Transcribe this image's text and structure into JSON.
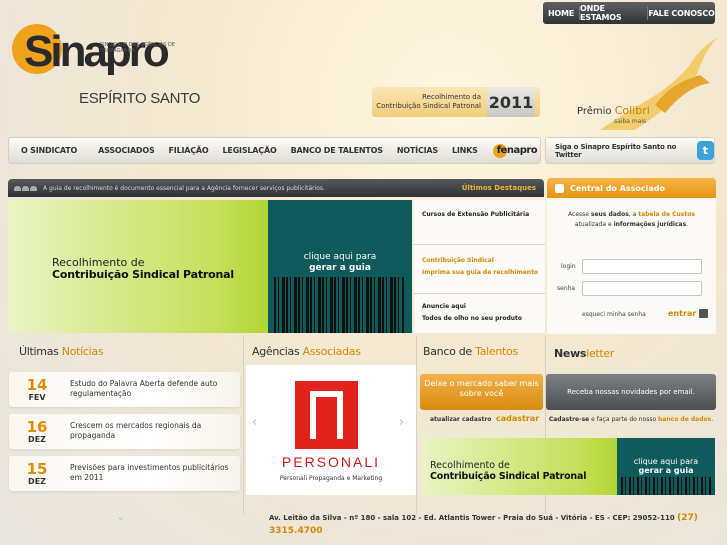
{
  "topnav": {
    "home": "HOME",
    "onde": "ONDE ESTAMOS",
    "fale": "FALE CONOSCO"
  },
  "logo": {
    "word": "Sinapro",
    "small": "SINDICATO DAS AGÊNCIAS DE PROPAGANDA",
    "sub": "ESPÍRITO SANTO"
  },
  "recolhimento": {
    "line1": "Recolhimento da",
    "line2": "Contribuição Sindical Patronal",
    "year": "2011"
  },
  "premio": {
    "label": "Prêmio ",
    "highlight": "Colibri",
    "saiba": "saiba mais"
  },
  "mainnav": {
    "items": [
      "O SINDICATO",
      "ASSOCIADOS",
      "FILIAÇÃO",
      "LEGISLAÇÃO",
      "BANCO DE TALENTOS",
      "NOTÍCIAS",
      "LINKS"
    ],
    "fenapro": "fenapro"
  },
  "twitter": {
    "label": "Siga o Sinapro Espírito Santo no Twitter",
    "icon": "twitter-icon"
  },
  "ticker": {
    "message": "A guia de recolhimento é documento essencial para a Agência fornecer serviços publicitários.",
    "destaques": "Últimos Destaques"
  },
  "banner": {
    "line1": "Recolhimento de",
    "line2": "Contribuição Sindical Patronal",
    "cta1": "clique aqui para",
    "cta2": "gerar a guia"
  },
  "destaques": [
    {
      "l1": "Cursos de Extensão Publicitária",
      "l2": ""
    },
    {
      "l1": "Contribuição Sindical",
      "l2": "Imprima sua guia de recolhimento"
    },
    {
      "l1": "Anuncie aqui",
      "l2": "Todos de olho no seu produto"
    }
  ],
  "central": {
    "title": "Central do Associado",
    "intro_a": "Acesse ",
    "intro_b": "seus dados",
    "intro_c": ", a ",
    "intro_d": "tabela de Custos",
    "intro_e": "atualizada e ",
    "intro_f": "informações jurídicas",
    "intro_g": ".",
    "login_label": "login",
    "senha_label": "senha",
    "login_value": "",
    "senha_value": "",
    "esqueci": "esqueci minha senha",
    "entrar": "entrar"
  },
  "sections": {
    "noticias_a": "Últimas ",
    "noticias_b": "Notícias",
    "agencias_a": "Agências ",
    "agencias_b": "Associadas",
    "talentos_a": "Banco de ",
    "talentos_b": "Talentos",
    "news_a": "News",
    "news_b": "letter"
  },
  "noticias": [
    {
      "day": "14",
      "month": "FEV",
      "title": "Estudo do Palavra Aberta defende auto regulamentação"
    },
    {
      "day": "16",
      "month": "DEZ",
      "title": "Crescem os mercados regionais da propaganda"
    },
    {
      "day": "15",
      "month": "DEZ",
      "title": "Previsões para investimentos publicitários em 2011"
    }
  ],
  "agency": {
    "brand": "PERSONALI",
    "desc": "Personali Propaganda e Marketing"
  },
  "talentos": {
    "box": "Deixe o mercado saber mais sobre você",
    "update": "atualizar cadastro",
    "cadastrar": "cadastrar"
  },
  "newsletter": {
    "box": "Receba nossas novidades por email.",
    "t1": "Cadastre-se",
    "t2": " e faça parte do nosso ",
    "t3": "banco de dados",
    "t4": "."
  },
  "banner2": {
    "line1": "Recolhimento de",
    "line2": "Contribuição Sindical Patronal",
    "cta1": "clique aqui para",
    "cta2": "gerar a guia"
  },
  "footer": {
    "address": "Av. Leitão da Silva - nº 180 - sala 102 - Ed. Atlantis Tower - Praia do Suá - Vitória - ES - CEP: 29052-110",
    "phone": "(27) 3315.4700"
  },
  "colors": {
    "accent": "#d48800",
    "teal": "#0f5a5a",
    "green": "#b2d536",
    "dark": "#2f3334"
  }
}
